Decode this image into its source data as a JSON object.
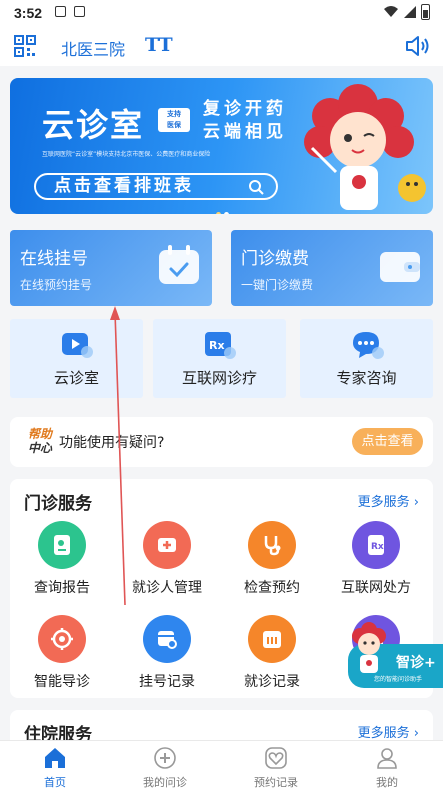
{
  "status_bar": {
    "time": "3:52"
  },
  "header": {
    "hospital": "北医三院",
    "font_size_label": "TT"
  },
  "banner": {
    "title": "云诊室",
    "badge_line1": "支持",
    "badge_line2": "医保",
    "slogan_line1": "复诊开药",
    "slogan_line2": "云端相见",
    "description": "互联网医院“云诊室”模块支持北京市医保、公费医疗和商业保险",
    "cta": "点击查看排班表"
  },
  "cards": [
    {
      "title": "在线挂号",
      "subtitle": "在线预约挂号"
    },
    {
      "title": "门诊缴费",
      "subtitle": "一键门诊缴费"
    }
  ],
  "services": [
    {
      "label": "云诊室"
    },
    {
      "label": "互联网诊疗"
    },
    {
      "label": "专家咨询"
    }
  ],
  "help": {
    "logo_line1": "帮助",
    "logo_line2": "中心",
    "question": "功能使用有疑问?",
    "button": "点击查看"
  },
  "outpatient": {
    "title": "门诊服务",
    "more": "更多服务",
    "items": [
      {
        "label": "查询报告"
      },
      {
        "label": "就诊人管理"
      },
      {
        "label": "检查预约"
      },
      {
        "label": "互联网处方"
      },
      {
        "label": "智能导诊"
      },
      {
        "label": "挂号记录"
      },
      {
        "label": "就诊记录"
      }
    ]
  },
  "assistant": {
    "title": "智诊+",
    "subtitle": "您的智能问诊助手"
  },
  "inpatient": {
    "title": "住院服务",
    "more": "更多服务"
  },
  "tabbar": [
    {
      "label": "首页"
    },
    {
      "label": "我的问诊"
    },
    {
      "label": "预约记录"
    },
    {
      "label": "我的"
    }
  ],
  "colors": {
    "accent": "#1b6fd8",
    "card_blue": "#4a9cf0",
    "help_button": "#f8b05a",
    "arrow": "#e05555"
  }
}
